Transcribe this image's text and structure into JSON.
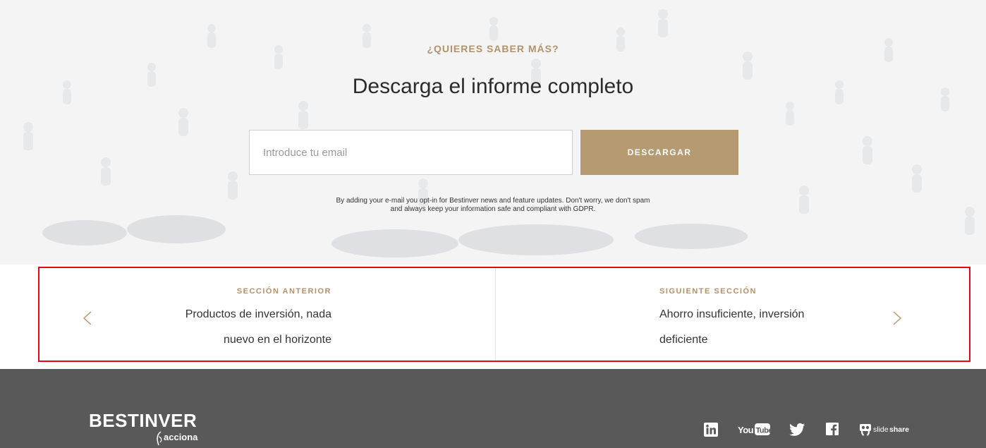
{
  "hero": {
    "eyebrow": "¿QUIERES SABER MÁS?",
    "title": "Descarga el informe completo",
    "email_placeholder": "Introduce tu email",
    "download_label": "DESCARGAR",
    "legal_line1": "By adding your e-mail you opt-in for Bestinver news and feature updates. Don't worry, we don't spam",
    "legal_line2": "and always keep your information safe and compliant with GDPR."
  },
  "section_nav": {
    "prev": {
      "label": "SECCIÓN ANTERIOR",
      "title": "Productos de inversión, nada nuevo en el horizonte",
      "icon": "chevron-left-icon"
    },
    "next": {
      "label": "SIGUIENTE SECCIÓN",
      "title": "Ahorro insuficiente, inversión deficiente",
      "icon": "chevron-right-icon"
    },
    "highlight_color": "#e30613"
  },
  "footer": {
    "brand": "BESTINVER",
    "brand_sub": "acciona",
    "social": [
      {
        "name": "linkedin",
        "icon": "linkedin-icon"
      },
      {
        "name": "youtube",
        "icon": "youtube-icon",
        "text": "You Tube"
      },
      {
        "name": "twitter",
        "icon": "twitter-icon"
      },
      {
        "name": "facebook",
        "icon": "facebook-icon"
      },
      {
        "name": "slideshare",
        "icon": "slideshare-icon",
        "text": "slideshare"
      }
    ]
  },
  "colors": {
    "accent_gold": "#b59a72",
    "footer_bg": "#595959",
    "text_dark": "#2b2b2b"
  }
}
